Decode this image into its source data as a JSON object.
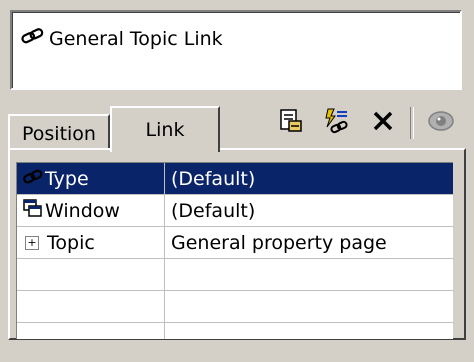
{
  "header": {
    "title": "General Topic Link",
    "title_icon": "chain-link-icon"
  },
  "tabs": [
    {
      "label": "Position",
      "active": false
    },
    {
      "label": "Link",
      "active": true
    }
  ],
  "toolbar": {
    "buttons": [
      {
        "icon": "document-properties-icon"
      },
      {
        "icon": "link-list-icon"
      },
      {
        "icon": "delete-x-icon"
      },
      {
        "icon": "eye-icon"
      }
    ]
  },
  "properties": {
    "rows": [
      {
        "name": "Type",
        "value": "(Default)",
        "icon": "chain-link-icon",
        "selected": true
      },
      {
        "name": "Window",
        "value": "(Default)",
        "icon": "window-icon",
        "selected": false
      },
      {
        "name": "Topic",
        "value": "General property page",
        "icon": "plus-expander-icon",
        "selected": false
      }
    ],
    "empty_rows": 2
  },
  "colors": {
    "selection": "#0a246a",
    "face": "#d4d0c8"
  }
}
